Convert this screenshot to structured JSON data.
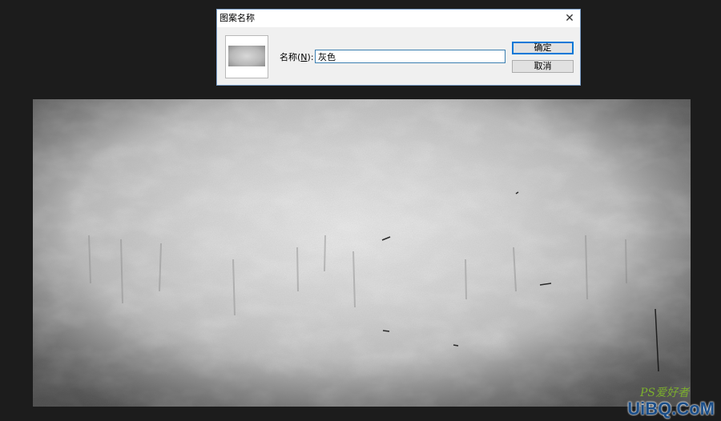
{
  "dialog": {
    "title": "图案名称",
    "name_label": "名称(",
    "name_hotkey": "N",
    "name_label_suffix": "):",
    "name_value": "灰色",
    "ok_label": "确定",
    "cancel_label": "取消",
    "close_glyph": "✕"
  },
  "watermark": {
    "ps_text": "PS爱好者",
    "site_text": "UiBQ.CoM"
  },
  "colors": {
    "app_background": "#1c1c1c",
    "dialog_background": "#f0f0f0",
    "accent": "#0078d7"
  }
}
